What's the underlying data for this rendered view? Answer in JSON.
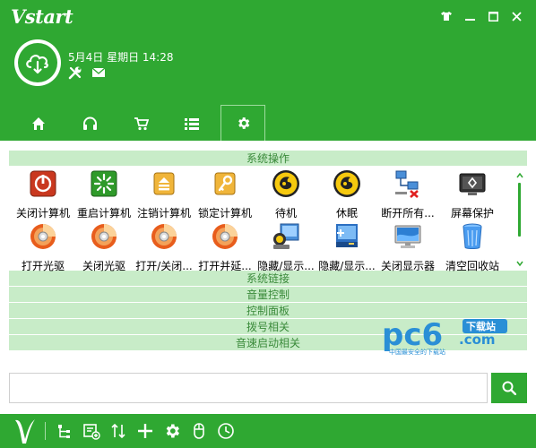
{
  "app": {
    "title": "Vstart",
    "accent": "#2fa832"
  },
  "window_controls": [
    "shirt-icon",
    "minimize-icon",
    "maximize-icon",
    "close-icon"
  ],
  "header": {
    "datetime": "5月4日 星期日 14:28",
    "tools": [
      "wrench-icon",
      "mail-icon"
    ]
  },
  "tabs": [
    {
      "icon": "home-icon",
      "active": false
    },
    {
      "icon": "headphones-icon",
      "active": false
    },
    {
      "icon": "cart-icon",
      "active": false
    },
    {
      "icon": "list-icon",
      "active": false
    },
    {
      "icon": "gear-icon",
      "active": true
    }
  ],
  "sections": {
    "system_ops": "系统操作",
    "system_links": "系统链接",
    "volume": "音量控制",
    "control_panel": "控制面板",
    "dialup": "拨号相关",
    "quick_launch": "音速启动相关"
  },
  "items": [
    {
      "label": "关闭计算机",
      "icon": "shutdown-icon"
    },
    {
      "label": "重启计算机",
      "icon": "restart-icon"
    },
    {
      "label": "注销计算机",
      "icon": "logoff-icon"
    },
    {
      "label": "锁定计算机",
      "icon": "lock-key-icon"
    },
    {
      "label": "待机",
      "icon": "standby-icon"
    },
    {
      "label": "休眠",
      "icon": "hibernate-icon"
    },
    {
      "label": "断开所有...",
      "icon": "disconnect-network-icon"
    },
    {
      "label": "屏幕保护",
      "icon": "screensaver-icon"
    },
    {
      "label": "打开光驱",
      "icon": "cd-drive-icon"
    },
    {
      "label": "关闭光驱",
      "icon": "cd-drive-icon"
    },
    {
      "label": "打开/关闭...",
      "icon": "cd-drive-icon"
    },
    {
      "label": "打开并延...",
      "icon": "cd-drive-icon"
    },
    {
      "label": "隐藏/显示...",
      "icon": "hide-show-icon"
    },
    {
      "label": "隐藏/显示...",
      "icon": "taskbar-icon"
    },
    {
      "label": "关闭显示器",
      "icon": "monitor-icon"
    },
    {
      "label": "清空回收站",
      "icon": "recycle-bin-icon"
    }
  ],
  "watermark": {
    "brand": "pc6",
    "tag": "下载站",
    "domain": ".com",
    "slogan": "中国最安全的下载站"
  },
  "search": {
    "value": "",
    "placeholder": ""
  },
  "footer_icons": [
    "tree-icon",
    "add-list-icon",
    "sort-icon",
    "plus-icon",
    "gear-icon",
    "mouse-icon",
    "clock-icon"
  ]
}
